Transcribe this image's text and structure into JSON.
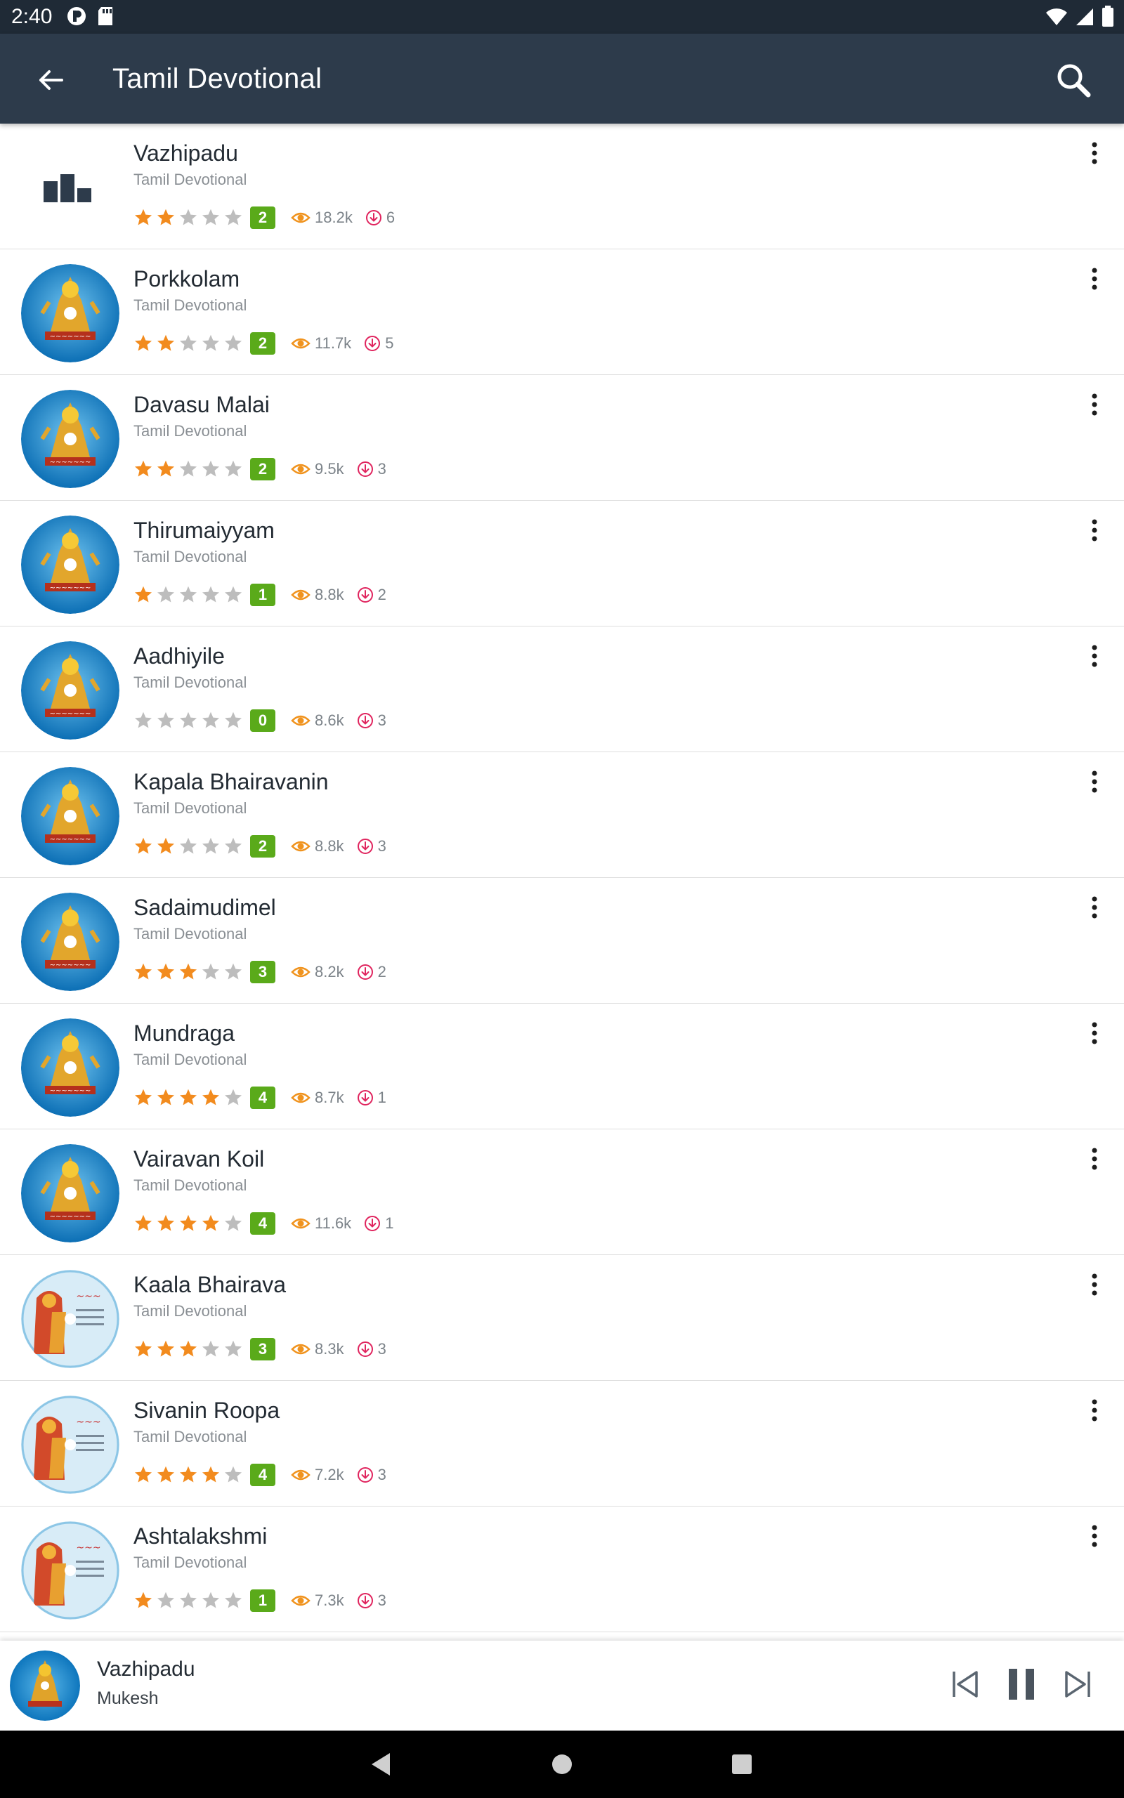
{
  "status_bar": {
    "time": "2:40"
  },
  "app_bar": {
    "title": "Tamil Devotional"
  },
  "colors": {
    "star_on": "#f28b1e",
    "star_off": "#bdbdbd",
    "badge": "#5aaa1a",
    "eye": "#f0931e",
    "download": "#e0245e",
    "app_bar": "#2d3b4b"
  },
  "songs": [
    {
      "title": "Vazhipadu",
      "subtitle": "Tamil Devotional",
      "rating": 2,
      "views": "18.2k",
      "downloads": "6",
      "art": "bars"
    },
    {
      "title": "Porkkolam",
      "subtitle": "Tamil Devotional",
      "rating": 2,
      "views": "11.7k",
      "downloads": "5",
      "art": "blue"
    },
    {
      "title": "Davasu Malai",
      "subtitle": "Tamil Devotional",
      "rating": 2,
      "views": "9.5k",
      "downloads": "3",
      "art": "blue"
    },
    {
      "title": "Thirumaiyyam",
      "subtitle": "Tamil Devotional",
      "rating": 1,
      "views": "8.8k",
      "downloads": "2",
      "art": "blue"
    },
    {
      "title": "Aadhiyile",
      "subtitle": "Tamil Devotional",
      "rating": 0,
      "views": "8.6k",
      "downloads": "3",
      "art": "blue"
    },
    {
      "title": "Kapala Bhairavanin",
      "subtitle": "Tamil Devotional",
      "rating": 2,
      "views": "8.8k",
      "downloads": "3",
      "art": "blue"
    },
    {
      "title": "Sadaimudimel",
      "subtitle": "Tamil Devotional",
      "rating": 3,
      "views": "8.2k",
      "downloads": "2",
      "art": "blue"
    },
    {
      "title": "Mundraga",
      "subtitle": "Tamil Devotional",
      "rating": 4,
      "views": "8.7k",
      "downloads": "1",
      "art": "blue"
    },
    {
      "title": "Vairavan Koil",
      "subtitle": "Tamil Devotional",
      "rating": 4,
      "views": "11.6k",
      "downloads": "1",
      "art": "blue"
    },
    {
      "title": "Kaala Bhairava",
      "subtitle": "Tamil Devotional",
      "rating": 3,
      "views": "8.3k",
      "downloads": "3",
      "art": "light"
    },
    {
      "title": "Sivanin Roopa",
      "subtitle": "Tamil Devotional",
      "rating": 4,
      "views": "7.2k",
      "downloads": "3",
      "art": "light"
    },
    {
      "title": "Ashtalakshmi",
      "subtitle": "Tamil Devotional",
      "rating": 1,
      "views": "7.3k",
      "downloads": "3",
      "art": "light"
    }
  ],
  "player": {
    "title": "Vazhipadu",
    "artist": "Mukesh"
  }
}
